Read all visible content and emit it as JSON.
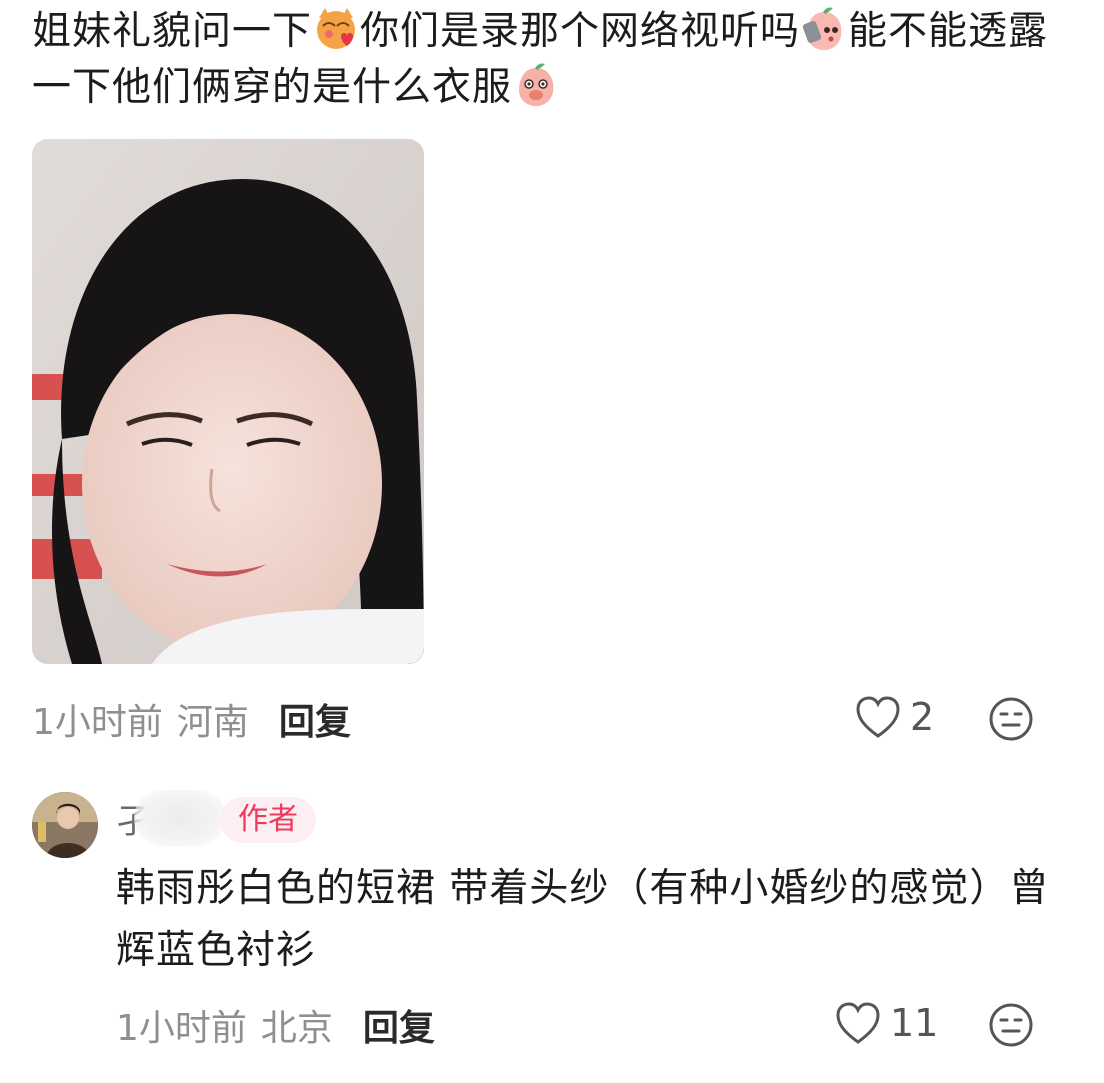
{
  "comment": {
    "line1": "姐妹礼貌问一下",
    "line2": "你们是录那个网络视听吗",
    "line3": "能不能透露一下他们俩穿的是什么衣服",
    "emojis": [
      "cat-heart-emoji",
      "phone-peach-emoji",
      "peach-cover-mouth-emoji"
    ],
    "time": "1小时前",
    "location": "河南",
    "reply_label": "回复",
    "likes": "2"
  },
  "reply": {
    "username_visible": "孑",
    "badge": "作者",
    "text": "韩雨彤白色的短裙 带着头纱（有种小婚纱的感觉）曾辉蓝色衬衫",
    "time": "1小时前",
    "location": "北京",
    "reply_label": "回复",
    "likes": "11"
  },
  "colors": {
    "badge_bg": "#fdeef1",
    "badge_text": "#ef3a5d",
    "meta_text": "#8f8f8f"
  }
}
